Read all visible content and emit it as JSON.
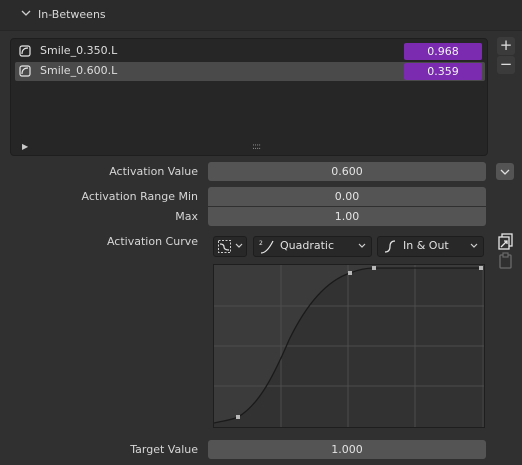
{
  "panel": {
    "title": "In-Betweens"
  },
  "list": {
    "rows": [
      {
        "name": "Smile_0.350.L",
        "value": "0.968"
      },
      {
        "name": "Smile_0.600.L",
        "value": "0.359"
      }
    ],
    "add_label": "+",
    "remove_label": "−",
    "grip": "::::"
  },
  "activation_value": {
    "label": "Activation  Value",
    "value": "0.600"
  },
  "range_min": {
    "label": "Activation Range Min",
    "value": "0.00"
  },
  "range_max": {
    "label": "Max",
    "value": "1.00"
  },
  "activation_curve": {
    "label": "Activation Curve",
    "interpolation": "Quadratic",
    "easing": "In & Out"
  },
  "target_value": {
    "label": "Target Value",
    "value": "1.000"
  },
  "colors": {
    "slider_purple": "#7a2bb0",
    "field_gray": "#545454",
    "bg": "#303030"
  }
}
